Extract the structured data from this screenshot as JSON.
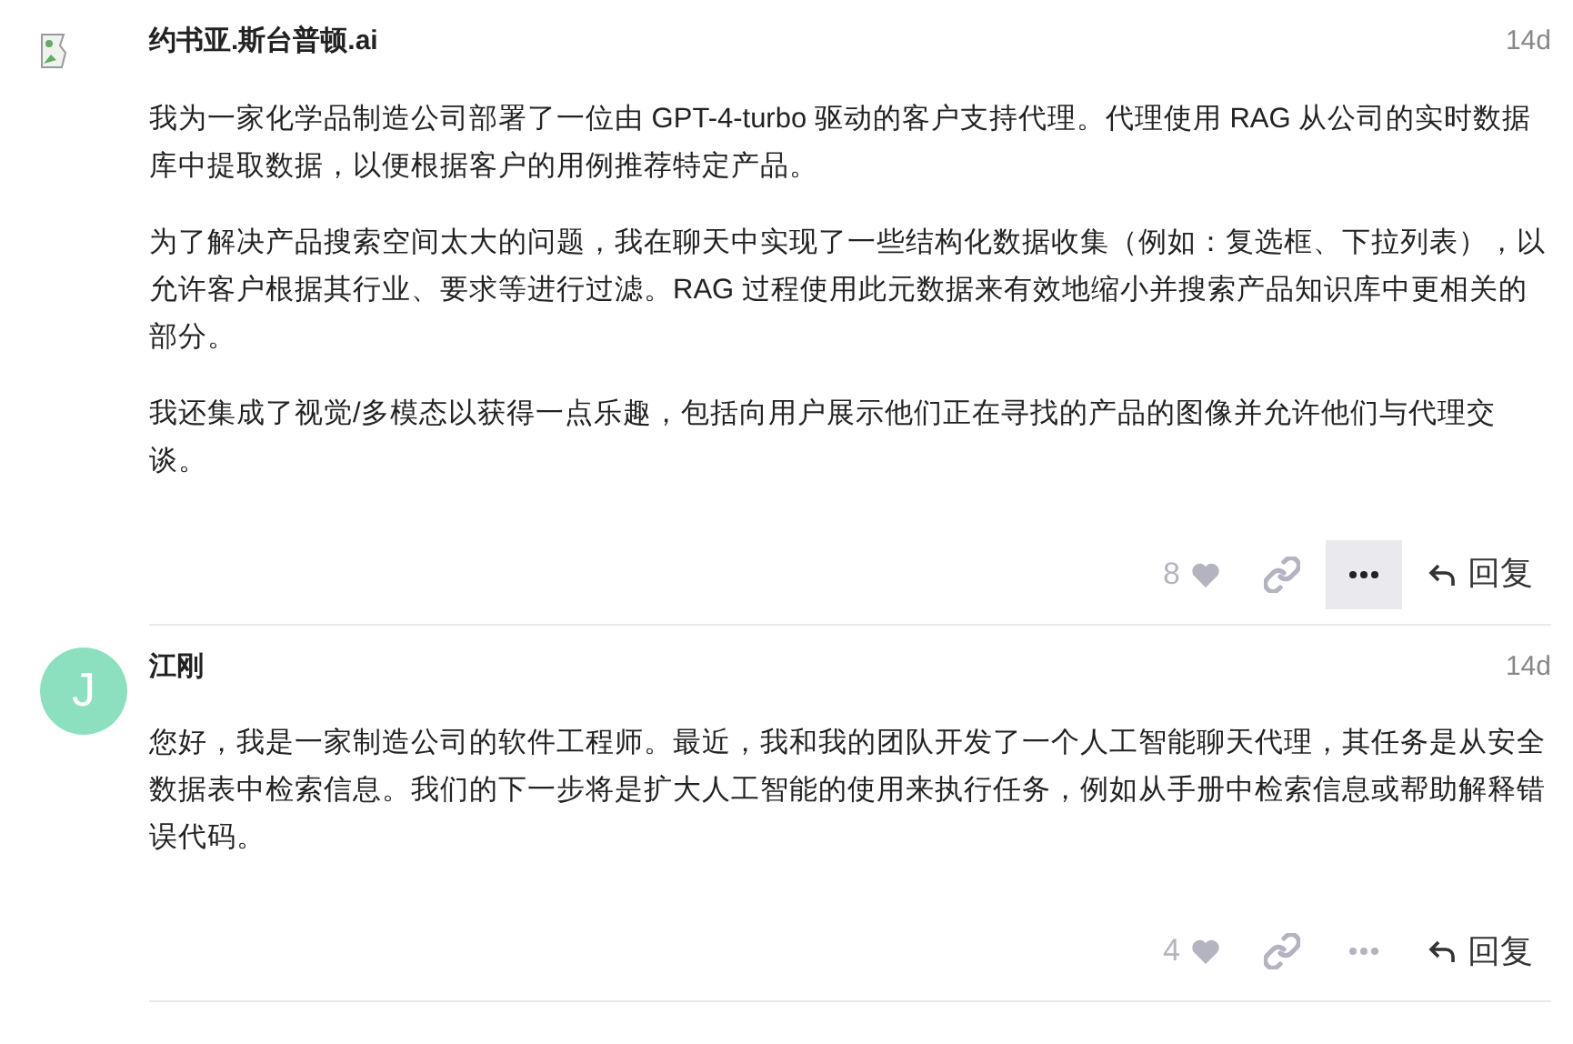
{
  "posts": [
    {
      "author": "约书亚.斯台普顿.ai",
      "avatar": {
        "kind": "broken"
      },
      "time": "14d",
      "paragraphs": [
        "我为一家化学品制造公司部署了一位由 GPT-4-turbo 驱动的客户支持代理。代理使用 RAG 从公司的实时数据库中提取数据，以便根据客户的用例推荐特定产品。",
        "为了解决产品搜索空间太大的问题，我在聊天中实现了一些结构化数据收集（例如：复选框、下拉列表），以允许客户根据其行业、要求等进行过滤。RAG 过程使用此元数据来有效地缩小并搜索产品知识库中更相关的部分。",
        "我还集成了视觉/多模态以获得一点乐趣，包括向用户展示他们正在寻找的产品的图像并允许他们与代理交谈。"
      ],
      "likes": "8",
      "more_hovered": true,
      "reply": "回复"
    },
    {
      "author": "江刚",
      "avatar": {
        "kind": "letter",
        "letter": "J"
      },
      "time": "14d",
      "paragraphs": [
        "您好，我是一家制造公司的软件工程师。最近，我和我的团队开发了一个人工智能聊天代理，其任务是从安全数据表中检索信息。我们的下一步将是扩大人工智能的使用来执行任务，例如从手册中检索信息或帮助解释错误代码。"
      ],
      "likes": "4",
      "more_hovered": false,
      "reply": "回复"
    }
  ]
}
